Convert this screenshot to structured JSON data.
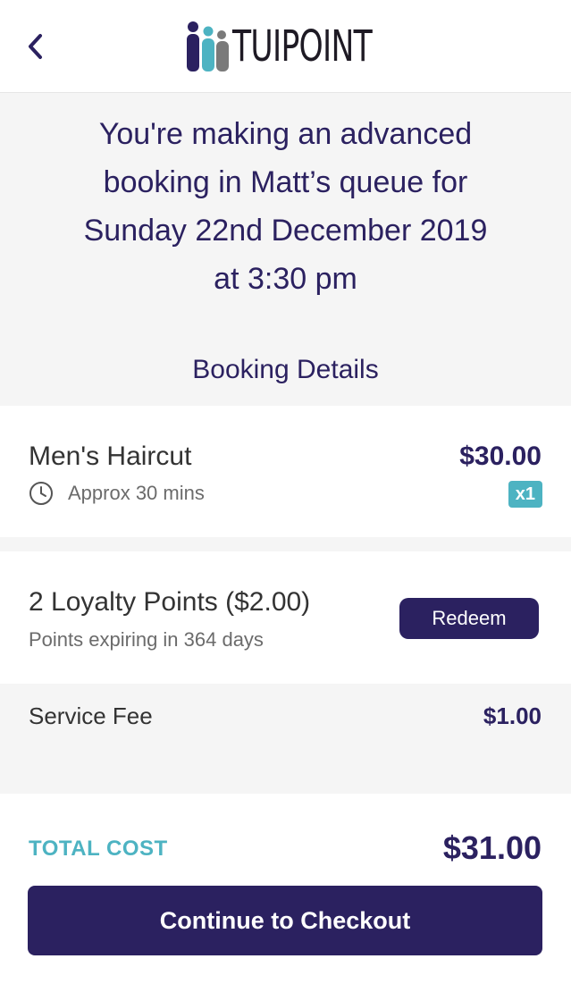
{
  "header": {
    "back_icon": "chevron-left-icon",
    "logo_icon": "tuipoint-logo-mark",
    "logo_text": "TUIPOINT"
  },
  "intro": {
    "line1": "You're making an advanced",
    "line2": "booking in Matt’s queue for",
    "line3": "Sunday 22nd December 2019",
    "line4": "at 3:30 pm"
  },
  "details_title": "Booking Details",
  "service": {
    "name": "Men's Haircut",
    "duration": "Approx 30 mins",
    "duration_icon": "clock-icon",
    "price": "$30.00",
    "quantity": "x1"
  },
  "loyalty": {
    "title": "2 Loyalty Points ($2.00)",
    "subtitle": "Points expiring in 364 days",
    "button_label": "Redeem"
  },
  "fee": {
    "label": "Service Fee",
    "amount": "$1.00"
  },
  "total": {
    "label": "TOTAL COST",
    "amount": "$31.00"
  },
  "checkout": {
    "button_label": "Continue to Checkout"
  },
  "colors": {
    "primary": "#2b2160",
    "accent": "#4db3c2",
    "background": "#f5f5f5"
  }
}
